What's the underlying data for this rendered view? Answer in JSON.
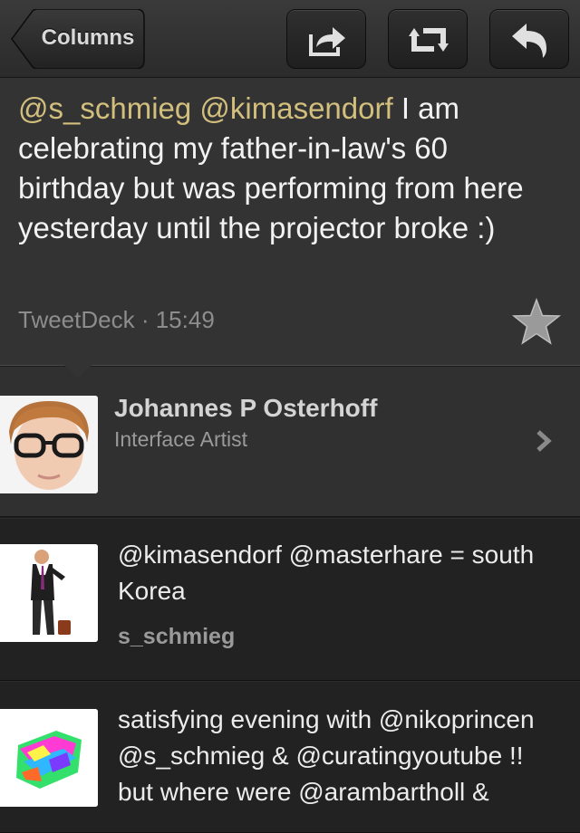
{
  "toolbar": {
    "back_label": "Columns",
    "share_icon": "share-icon",
    "retweet_icon": "retweet-icon",
    "reply_icon": "reply-icon"
  },
  "tweet": {
    "mention1": "@s_schmieg",
    "mention2": "@kimasendorf",
    "body": " I am celebrating my father-in-law's 60 birthday but was performing from here yesterday until the projector broke :)",
    "source": "TweetDeck",
    "separator": " · ",
    "time": "15:49",
    "favorite_icon": "star-icon"
  },
  "profile": {
    "name": "Johannes P Osterhoff",
    "bio": "Interface Artist",
    "avatar_icon": "avatar-photo"
  },
  "timeline": [
    {
      "text": "@kimasendorf @masterhare = south Korea",
      "user": "s_schmieg"
    },
    {
      "text": "satisfying evening with @nikoprincen @s_schmieg & @curatingyoutube !! but where were @arambartholl &",
      "user": ""
    }
  ],
  "colors": {
    "mention": "#d3bf7d",
    "panel": "#333333",
    "list_bg": "#222222"
  }
}
